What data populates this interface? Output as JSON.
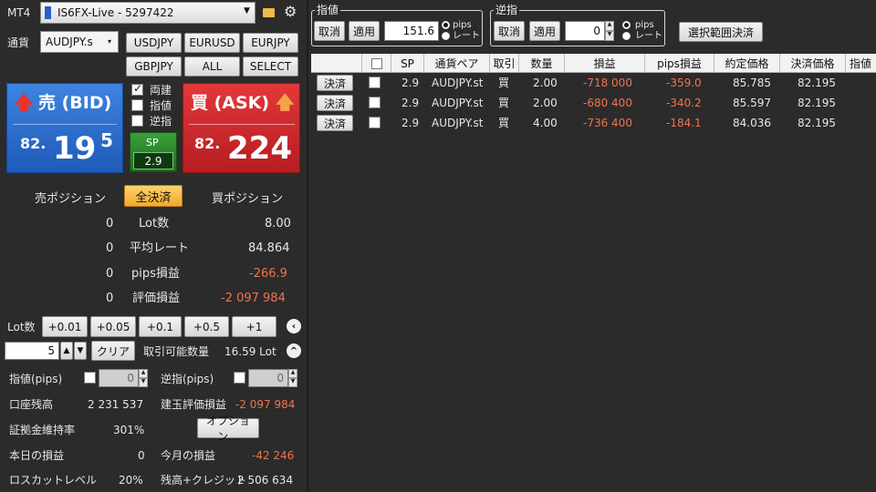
{
  "top": {
    "mt4_label": "MT4",
    "account_select": "IS6FX-Live - 5297422"
  },
  "currency": {
    "label": "通貨",
    "selected": "AUDJPY.s",
    "buttons": [
      "USDJPY",
      "EURUSD",
      "EURJPY",
      "GBPJPY",
      "ALL",
      "SELECT"
    ]
  },
  "bid": {
    "label": "売 (BID)",
    "price_small": "82.",
    "price_big": "19",
    "price_sup": "5"
  },
  "ask": {
    "label": "買 (ASK)",
    "price_small": "82.",
    "price_big": "224"
  },
  "options": {
    "both": "両建",
    "limit": "指値",
    "stop": "逆指"
  },
  "spread": {
    "label": "SP",
    "value": "2.9"
  },
  "positions": {
    "sell_label": "売ポジション",
    "close_all": "全決済",
    "buy_label": "買ポジション",
    "rows": [
      {
        "sell": "0",
        "label": "Lot数",
        "buy": "8.00"
      },
      {
        "sell": "0",
        "label": "平均レート",
        "buy": "84.864"
      },
      {
        "sell": "0",
        "label": "pips損益",
        "buy": "-266.9"
      },
      {
        "sell": "0",
        "label": "評価損益",
        "buy": "-2 097 984"
      }
    ]
  },
  "lot": {
    "label": "Lot数",
    "increments": [
      "+0.01",
      "+0.05",
      "+0.1",
      "+0.5",
      "+1"
    ],
    "value": "5",
    "clear": "クリア",
    "tradable_label": "取引可能数量",
    "tradable_value": "16.59 Lot"
  },
  "orders": {
    "limit_label": "指値(pips)",
    "limit_value": "0",
    "stop_label": "逆指(pips)",
    "stop_value": "0"
  },
  "account": {
    "balance_label": "口座残高",
    "balance_value": "2 231 537",
    "unrealized_label": "建玉評価損益",
    "unrealized_value": "-2 097 984",
    "margin_label": "証拠金維持率",
    "margin_value": "301%",
    "option_button": "オプション...",
    "today_label": "本日の損益",
    "today_value": "0",
    "month_label": "今月の損益",
    "month_value": "-42 246",
    "losscut_label": "ロスカットレベル",
    "losscut_value": "20%",
    "credit_label": "残高+クレジット",
    "credit_value": "2 506 634"
  },
  "limit_group": {
    "title": "指値",
    "cancel": "取消",
    "apply": "適用",
    "value": "151.6",
    "pips": "pips",
    "rate": "レート"
  },
  "stop_group": {
    "title": "逆指",
    "cancel": "取消",
    "apply": "適用",
    "value": "0",
    "pips": "pips",
    "rate": "レート"
  },
  "bulk_close": "選択範囲決済",
  "table": {
    "headers": [
      "",
      "",
      "SP",
      "通貨ペア",
      "取引",
      "数量",
      "損益",
      "pips損益",
      "約定価格",
      "決済価格",
      "指値"
    ],
    "close_label": "決済",
    "rows": [
      {
        "sp": "2.9",
        "pair": "AUDJPY.st",
        "side": "買",
        "qty": "2.00",
        "pl": "-718 000",
        "pips": "-359.0",
        "entry": "85.785",
        "exit": "82.195"
      },
      {
        "sp": "2.9",
        "pair": "AUDJPY.st",
        "side": "買",
        "qty": "2.00",
        "pl": "-680 400",
        "pips": "-340.2",
        "entry": "85.597",
        "exit": "82.195"
      },
      {
        "sp": "2.9",
        "pair": "AUDJPY.st",
        "side": "買",
        "qty": "4.00",
        "pl": "-736 400",
        "pips": "-184.1",
        "entry": "84.036",
        "exit": "82.195"
      }
    ]
  },
  "colors": {
    "bid_blue": "#2a6fd0",
    "ask_red": "#d0282c",
    "spread_green": "#2f8a2f",
    "loss_red": "#f2724d",
    "close_all_orange": "#f5b53c"
  }
}
